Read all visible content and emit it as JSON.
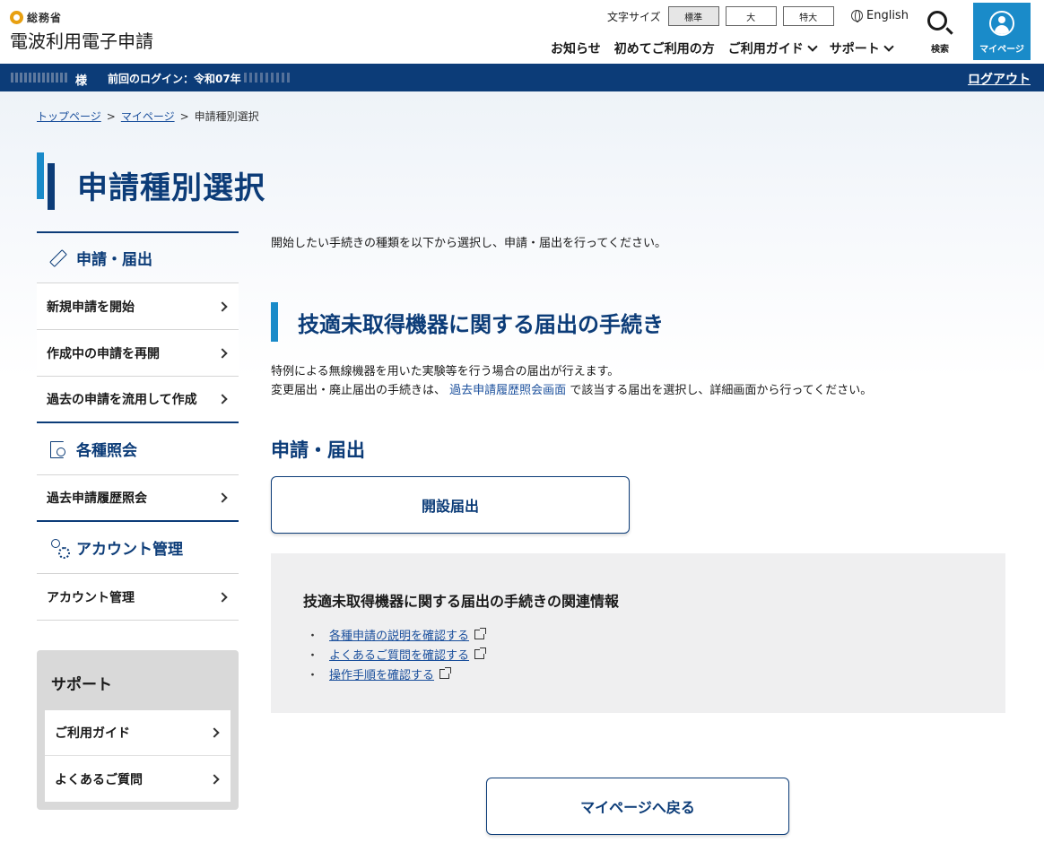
{
  "header": {
    "org": "総務省",
    "site_title": "電波利用電子申請",
    "font_size_label": "文字サイズ",
    "font_sizes": [
      "標準",
      "大",
      "特大"
    ],
    "language": "English",
    "nav": [
      "お知らせ",
      "初めてご利用の方",
      "ご利用ガイド",
      "サポート"
    ],
    "search_label": "検索",
    "mypage_label": "マイページ"
  },
  "userbar": {
    "honorific": "様",
    "last_login": "前回のログイン：令和07年",
    "logout": "ログアウト"
  },
  "breadcrumb": [
    "トップページ",
    "マイページ",
    "申請種別選択"
  ],
  "page_title": "申請種別選択",
  "sidebar": {
    "groups": [
      {
        "title": "申請・届出",
        "icon": "pencil-icon",
        "items": [
          "新規申請を開始",
          "作成中の申請を再開",
          "過去の申請を流用して作成"
        ]
      },
      {
        "title": "各種照会",
        "icon": "doc-search-icon",
        "items": [
          "過去申請履歴照会"
        ]
      },
      {
        "title": "アカウント管理",
        "icon": "user-gear-icon",
        "items": [
          "アカウント管理"
        ]
      }
    ],
    "support": {
      "title": "サポート",
      "items": [
        "ご利用ガイド",
        "よくあるご質問"
      ]
    }
  },
  "main": {
    "intro": "開始したい手続きの種類を以下から選択し、申請・届出を行ってください。",
    "section_title": "技適未取得機器に関する届出の手続き",
    "desc_line1": "特例による無線機器を用いた実験等を行う場合の届出が行えます。",
    "desc_line2_pre": "変更届出・廃止届出の手続きは、",
    "desc_line2_link": "過去申請履歴照会画面",
    "desc_line2_post": "で該当する届出を選択し、詳細画面から行ってください。",
    "sub_title": "申請・届出",
    "action_button": "開設届出",
    "related_title": "技適未取得機器に関する届出の手続きの関連情報",
    "related_links": [
      "各種申請の説明を確認する",
      "よくあるご質問を確認する",
      "操作手順を確認する"
    ],
    "back_button": "マイページへ戻る"
  },
  "colors": {
    "primary": "#0c3c78",
    "accent": "#1a8bc9"
  }
}
